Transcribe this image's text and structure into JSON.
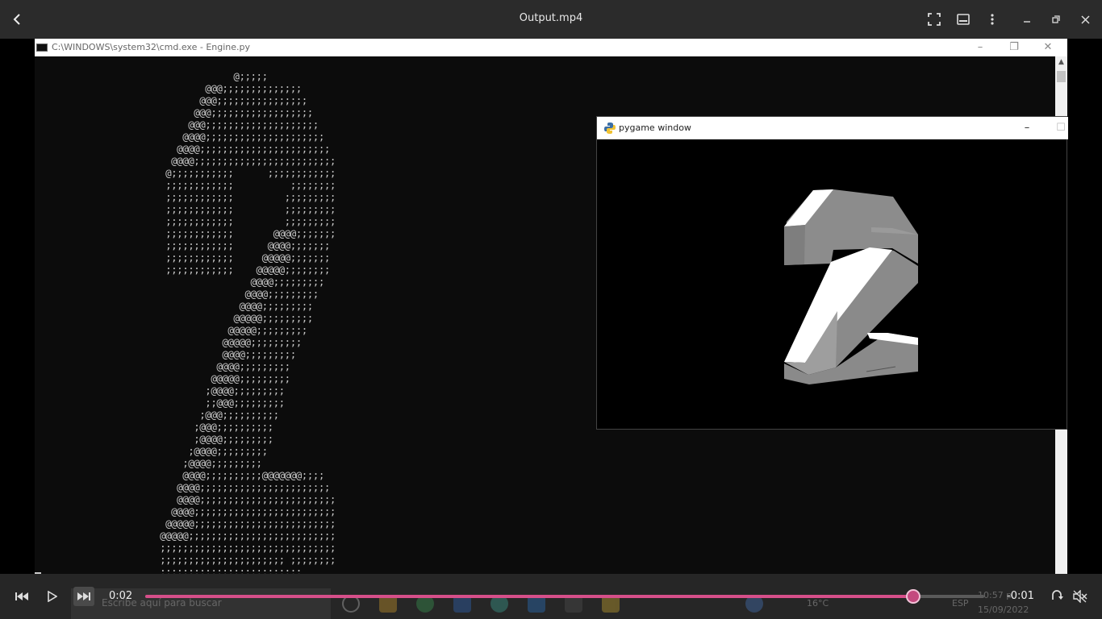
{
  "player": {
    "title": "Output.mp4",
    "back_icon": "back-arrow-icon",
    "controls": {
      "current_time": "0:02",
      "remaining_time": "-0:01",
      "progress": 0.915,
      "accent_color": "#d64f8a"
    }
  },
  "cmd_window": {
    "title": "C:\\WINDOWS\\system32\\cmd.exe - Engine.py",
    "ascii_art": "                 @;;;;;\n            @@@;;;;;;;;;;;;;;\n           @@@;;;;;;;;;;;;;;;;\n          @@@;;;;;;;;;;;;;;;;;;\n         @@@;;;;;;;;;;;;;;;;;;;;\n        @@@@;;;;;;;;;;;;;;;;;;;;;\n       @@@@;;;;;;;;;;;;;;;;;;;;;;;\n      @@@@;;;;;;;;;;;;;;;;;;;;;;;;;\n     @;;;;;;;;;;;      ;;;;;;;;;;;;\n     ;;;;;;;;;;;;          ;;;;;;;;\n     ;;;;;;;;;;;;         ;;;;;;;;;\n     ;;;;;;;;;;;;         ;;;;;;;;;\n     ;;;;;;;;;;;;         ;;;;;;;;;\n     ;;;;;;;;;;;;       @@@@;;;;;;;\n     ;;;;;;;;;;;;      @@@@;;;;;;;\n     ;;;;;;;;;;;;     @@@@@;;;;;;;\n     ;;;;;;;;;;;;    @@@@@;;;;;;;;\n                    @@@@;;;;;;;;;\n                   @@@@;;;;;;;;;\n                  @@@@;;;;;;;;;\n                 @@@@@;;;;;;;;;\n                @@@@@;;;;;;;;;\n               @@@@@;;;;;;;;;\n               @@@@;;;;;;;;;\n              @@@@;;;;;;;;;\n             @@@@@;;;;;;;;;\n            ;@@@@;;;;;;;;;\n            ;;@@@;;;;;;;;;\n           ;@@@;;;;;;;;;;\n          ;@@@;;;;;;;;;;\n          ;@@@@;;;;;;;;;\n         ;@@@@;;;;;;;;;\n        ;@@@@;;;;;;;;;\n        @@@@;;;;;;;;;;@@@@@@@;;;;\n       @@@@;;;;;;;;;;;;;;;;;;;;;;;\n       @@@@;;;;;;;;;;;;;;;;;;;;;;;;\n      @@@@;;;;;;;;;;;;;;;;;;;;;;;;;\n     @@@@@;;;;;;;;;;;;;;;;;;;;;;;;;\n    @@@@@;;;;;;;;;;;;;;;;;;;;;;;;;;\n    ;;;;;;;;;;;;;;;;;;;;;;;;;;;;;;;\n    ;;;;;;;;;;;;;;;;;;;;;; ;;;;;;;;\n    ;;;;;;;;;;;;;;;;;;;;;;;;;"
  },
  "pygame_window": {
    "title": "pygame window",
    "minimize": "–",
    "maximize": "☐"
  },
  "taskbar_ghost": {
    "search_placeholder": "Escribe aquí para buscar",
    "weather": "16°C",
    "language": "ESP",
    "clock_time": "10:57 p.",
    "clock_date": "15/09/2022"
  }
}
